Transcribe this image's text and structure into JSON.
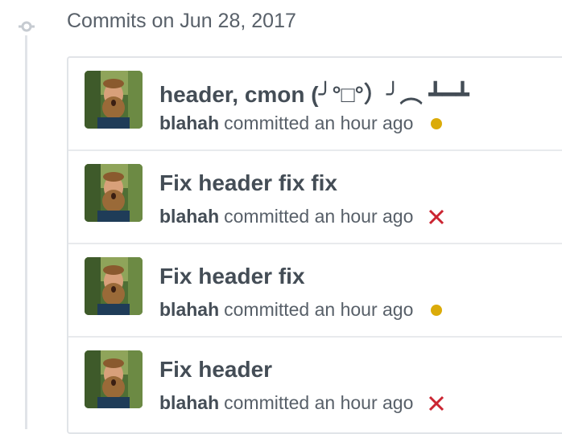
{
  "group": {
    "header": "Commits on Jun 28, 2017"
  },
  "colors": {
    "pending": "#dbab09",
    "failure": "#cb2431",
    "rail": "#e1e4e8"
  },
  "commits": [
    {
      "message": "header, cmon (╯°□°）╯︵ ┻━┻",
      "author": "blahah",
      "action": "committed an hour ago",
      "status": "pending",
      "status_icon": "pending-dot-icon"
    },
    {
      "message": "Fix header fix fix",
      "author": "blahah",
      "action": "committed an hour ago",
      "status": "failure",
      "status_icon": "x-icon"
    },
    {
      "message": "Fix header fix",
      "author": "blahah",
      "action": "committed an hour ago",
      "status": "pending",
      "status_icon": "pending-dot-icon"
    },
    {
      "message": "Fix header",
      "author": "blahah",
      "action": "committed an hour ago",
      "status": "failure",
      "status_icon": "x-icon"
    }
  ]
}
